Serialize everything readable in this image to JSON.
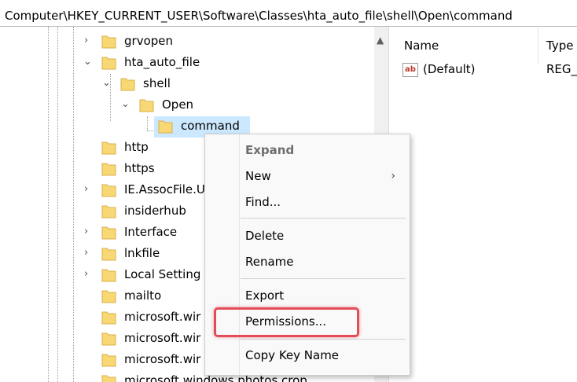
{
  "address": "Computer\\HKEY_CURRENT_USER\\Software\\Classes\\hta_auto_file\\shell\\Open\\command",
  "tree": {
    "items": [
      {
        "label": "grvopen",
        "chevron": "›"
      },
      {
        "label": "hta_auto_file",
        "chevron": "⌄"
      },
      {
        "label": "shell",
        "chevron": "⌄"
      },
      {
        "label": "Open",
        "chevron": "⌄"
      },
      {
        "label": "command",
        "chevron": ""
      },
      {
        "label": "http",
        "chevron": ""
      },
      {
        "label": "https",
        "chevron": ""
      },
      {
        "label": "IE.AssocFile.U",
        "chevron": "›"
      },
      {
        "label": "insiderhub",
        "chevron": ""
      },
      {
        "label": "Interface",
        "chevron": "›"
      },
      {
        "label": "lnkfile",
        "chevron": "›"
      },
      {
        "label": "Local Setting",
        "chevron": "›"
      },
      {
        "label": "mailto",
        "chevron": ""
      },
      {
        "label": "microsoft.wir",
        "chevron": ""
      },
      {
        "label": "microsoft.wir",
        "chevron": ""
      },
      {
        "label": "microsoft.wir",
        "chevron": ""
      },
      {
        "label": "microsoft.windows.photos.crop",
        "chevron": ""
      }
    ]
  },
  "values_pane": {
    "columns": {
      "name": "Name",
      "type": "Type"
    },
    "rows": [
      {
        "name": "(Default)",
        "type": "REG_",
        "icon": "ab"
      }
    ]
  },
  "context_menu": {
    "items": [
      {
        "label": "Expand"
      },
      {
        "label": "New"
      },
      {
        "label": "Find..."
      },
      {
        "label": "Delete"
      },
      {
        "label": "Rename"
      },
      {
        "label": "Export"
      },
      {
        "label": "Permissions..."
      },
      {
        "label": "Copy Key Name"
      }
    ],
    "submenu_arrow": "›"
  },
  "colors": {
    "folder": "#f8d775",
    "selection": "#cce8ff",
    "highlight": "#e34d56"
  }
}
